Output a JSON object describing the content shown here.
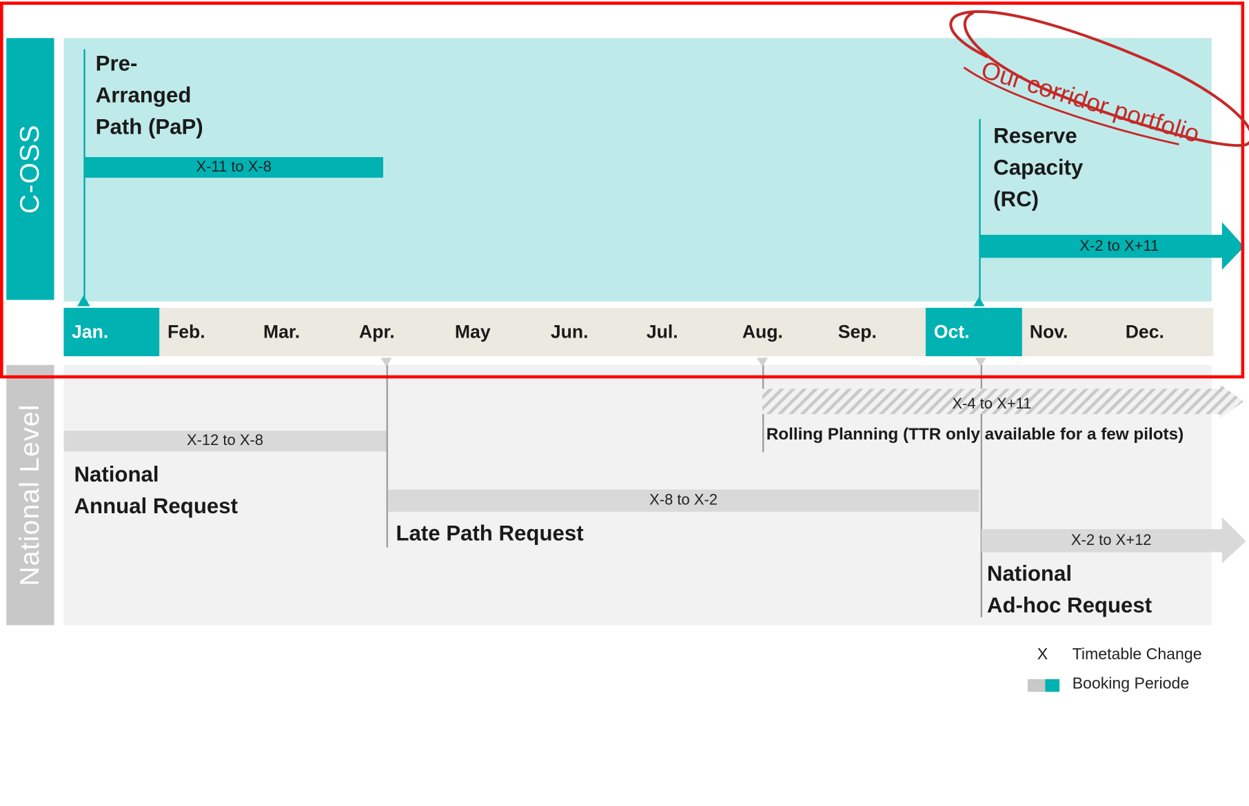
{
  "sections": {
    "coss_label": "C-OSS",
    "national_label": "National Level"
  },
  "months": [
    "Jan.",
    "Feb.",
    "Mar.",
    "Apr.",
    "May",
    "Jun.",
    "Jul.",
    "Aug.",
    "Sep.",
    "Oct.",
    "Nov.",
    "Dec."
  ],
  "highlighted_months": [
    "Jan.",
    "Oct."
  ],
  "coss": {
    "pap": {
      "title_lines": [
        "Pre-",
        "Arranged",
        "Path (PaP)"
      ],
      "period": "X-11 to X-8"
    },
    "rc": {
      "title_lines": [
        "Reserve",
        "Capacity",
        "(RC)"
      ],
      "period": "X-2 to X+11"
    }
  },
  "national": {
    "annual": {
      "title_lines": [
        "National",
        "Annual Request"
      ],
      "period": "X-12 to X-8"
    },
    "late": {
      "title": "Late Path Request",
      "period": "X-8 to X-2"
    },
    "rolling": {
      "title": "Rolling Planning (TTR only available for a few pilots)",
      "period": "X-4 to X+11"
    },
    "adhoc": {
      "title_lines": [
        "National",
        "Ad-hoc Request"
      ],
      "period": "X-2 to X+12"
    }
  },
  "annotation": {
    "text": "Our corridor portfolio"
  },
  "legend": {
    "x_symbol": "X",
    "x_text": "Timetable Change",
    "booking_text": "Booking Periode"
  },
  "colors": {
    "teal": "#00b2b2",
    "light_teal": "#bfeaea",
    "grey": "#d9d9d9",
    "highlight_red": "#ff0000",
    "annotation_red": "#c62828"
  }
}
